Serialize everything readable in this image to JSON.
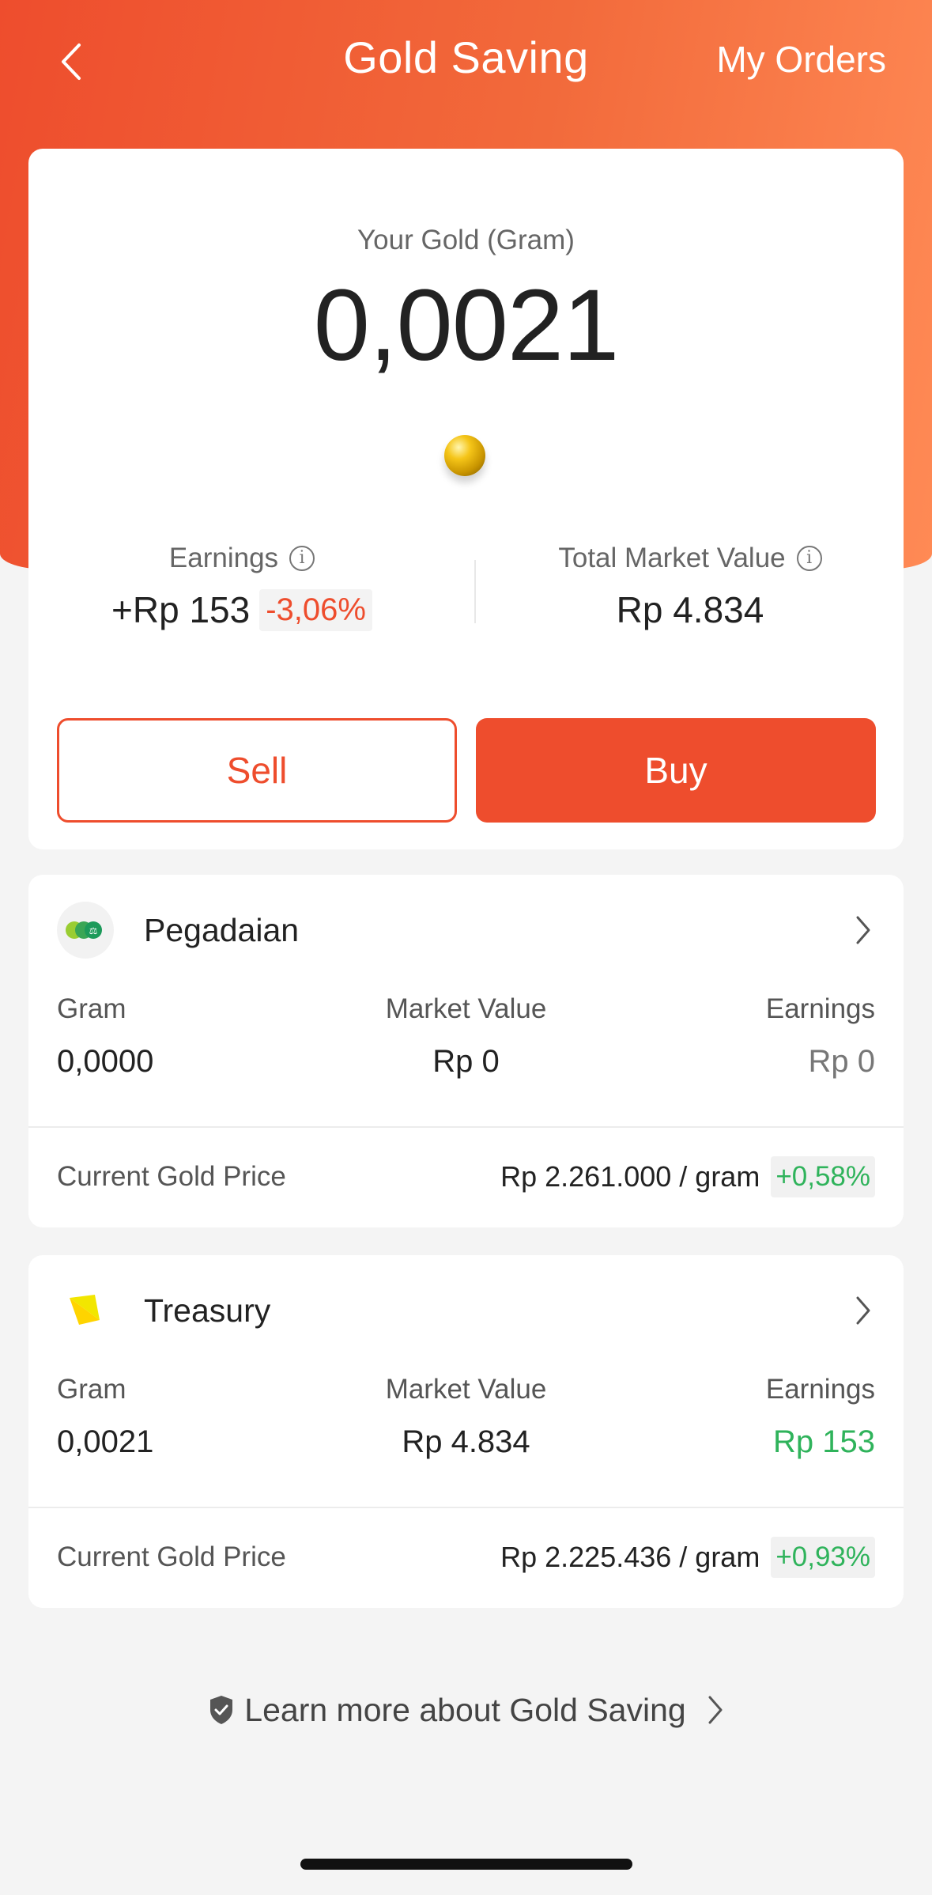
{
  "header": {
    "title": "Gold Saving",
    "orders_link": "My Orders"
  },
  "summary": {
    "gold_label": "Your Gold (Gram)",
    "gold_value": "0,0021",
    "earnings_label": "Earnings",
    "earnings_value": "+Rp 153",
    "earnings_change": "-3,06%",
    "market_label": "Total Market Value",
    "market_value": "Rp 4.834",
    "sell_label": "Sell",
    "buy_label": "Buy"
  },
  "providers": [
    {
      "name": "Pegadaian",
      "gram_label": "Gram",
      "gram_value": "0,0000",
      "market_label": "Market Value",
      "market_value": "Rp 0",
      "earnings_label": "Earnings",
      "earnings_value": "Rp 0",
      "price_label": "Current Gold Price",
      "price_value": "Rp 2.261.000 / gram",
      "price_change": "+0,58%"
    },
    {
      "name": "Treasury",
      "gram_label": "Gram",
      "gram_value": "0,0021",
      "market_label": "Market Value",
      "market_value": "Rp 4.834",
      "earnings_label": "Earnings",
      "earnings_value": "Rp 153",
      "price_label": "Current Gold Price",
      "price_value": "Rp 2.225.436 / gram",
      "price_change": "+0,93%"
    }
  ],
  "footer": {
    "learn_more": "Learn more about Gold Saving"
  },
  "colors": {
    "brand": "#ee4d2d",
    "positive": "#2fb35b",
    "negative": "#ee4d2d",
    "muted_earnings": "#777777"
  },
  "icons": [
    "back-arrow-icon",
    "info-icon",
    "chevron-right-icon",
    "shield-icon",
    "gold-ball-icon",
    "pegadaian-logo",
    "treasury-logo"
  ]
}
